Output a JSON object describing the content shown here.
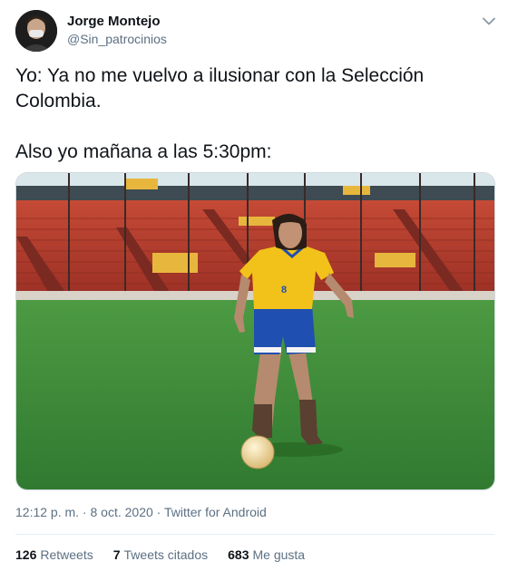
{
  "author": {
    "display_name": "Jorge Montejo",
    "handle": "@Sin_patrocinios"
  },
  "icons": {
    "avatar": "avatar-photo",
    "menu": "chevron-down-icon"
  },
  "tweet": {
    "line1": "Yo: Ya no me vuelvo a ilusionar con la Selección Colombia.",
    "line2": "Also yo mañana a las 5:30pm:"
  },
  "meta": {
    "time": "12:12 p. m.",
    "sep1": " · ",
    "date": "8 oct. 2020",
    "sep2": " · ",
    "source": "Twitter for Android"
  },
  "stats": {
    "retweets_count": "126",
    "retweets_label": "Retweets",
    "quotes_count": "7",
    "quotes_label": "Tweets citados",
    "likes_count": "683",
    "likes_label": "Me gusta"
  },
  "colors": {
    "text": "#0f1419",
    "secondary": "#5b7083",
    "jersey_yellow": "#f2c21a",
    "shorts_blue": "#1f4fb0",
    "stadium_red": "#b33a2c",
    "pitch_green": "#3f8f3a"
  }
}
